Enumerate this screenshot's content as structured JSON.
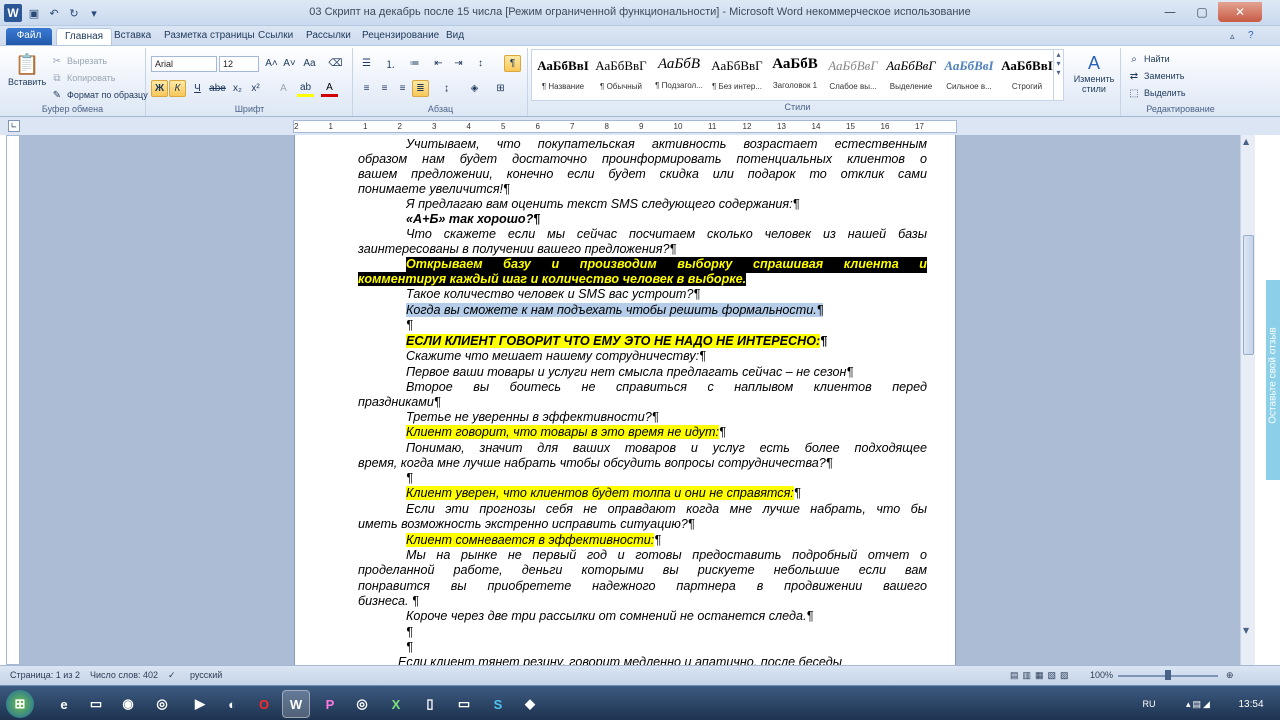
{
  "window": {
    "title": "03 Скрипт на декабрь после 15 числа [Режим ограниченной функциональности]  -  Microsoft Word некоммерческое использование",
    "app_logo": "W"
  },
  "tabs": [
    "Файл",
    "Главная",
    "Вставка",
    "Разметка страницы",
    "Ссылки",
    "Рассылки",
    "Рецензирование",
    "Вид"
  ],
  "ribbon": {
    "clipboard": {
      "paste": "Вставить",
      "cut": "Вырезать",
      "copy": "Копировать",
      "format_painter": "Формат по образцу",
      "label": "Буфер обмена"
    },
    "font": {
      "name": "Arial",
      "size": "12",
      "label": "Шрифт"
    },
    "paragraph_label": "Абзац",
    "styles": {
      "label": "Стили",
      "items": [
        {
          "sample": "АаБбВвI",
          "name": "¶ Название"
        },
        {
          "sample": "АаБбВвГ",
          "name": "¶ Обычный"
        },
        {
          "sample": "АаБбВ",
          "name": "¶ Подзагол..."
        },
        {
          "sample": "АаБбВвГ",
          "name": "¶ Без интер..."
        },
        {
          "sample": "АаБбВ",
          "name": "Заголовок 1"
        },
        {
          "sample": "АаБбВвГ",
          "name": "Слабое вы..."
        },
        {
          "sample": "АаБбВвГ",
          "name": "Выделение"
        },
        {
          "sample": "АаБбВвІ",
          "name": "Сильное в..."
        },
        {
          "sample": "АаБбВвІ",
          "name": "Строгий"
        }
      ],
      "change": "Изменить стили"
    },
    "editing": {
      "find": "Найти",
      "replace": "Заменить",
      "select": "Выделить",
      "label": "Редактирование"
    }
  },
  "ruler_numbers": [
    "2",
    "1",
    "1",
    "2",
    "3",
    "4",
    "5",
    "6",
    "7",
    "8",
    "9",
    "10",
    "11",
    "12",
    "13",
    "14",
    "15",
    "16",
    "17"
  ],
  "document_lines": [
    {
      "t": "Учитываем, что покупательская активность возрастает естественным"
    },
    {
      "t": "образом нам будет достаточно проинформировать потенциальных клиентов о"
    },
    {
      "t": "вашем предложении, конечно если будет скидка или подарок то отклик сами"
    },
    {
      "t": "понимаете увеличится!¶"
    },
    {
      "t": "Я предлагаю вам оценить текст SMS следующего содержания:¶"
    },
    {
      "t": "«А+Б» так хорошо?¶"
    },
    {
      "t": "Что скажете если мы сейчас посчитаем сколько человек из нашей базы"
    },
    {
      "t": "заинтересованы в получении вашего предложения?¶"
    },
    {
      "t": "Открываем базу и производим выборку спрашивая клиента и"
    },
    {
      "t": "комментируя каждый шаг и количество человек в выборке."
    },
    {
      "t": "Такое количество человек и SMS вас устроит?¶"
    },
    {
      "t": "Когда вы сможете к нам подъехать чтобы решить формальности.¶"
    },
    {
      "t": "¶"
    },
    {
      "t": "ЕСЛИ КЛИЕНТ ГОВОРИТ ЧТО ЕМУ ЭТО НЕ НАДО НЕ ИНТЕРЕСНО:"
    },
    {
      "t": "Скажите что мешает нашему сотрудничеству:¶"
    },
    {
      "t": "Первое ваши товары и услуги нет смысла предлагать сейчас – не сезон¶"
    },
    {
      "t": "Второе вы боитесь не справиться с наплывом клиентов перед"
    },
    {
      "t": "праздниками¶"
    },
    {
      "t": "Третье не уверенны в эффективности?¶"
    },
    {
      "t": "Клиент говорит, что товары в это время не идут:"
    },
    {
      "t": "Понимаю, значит для ваших товаров и услуг есть более подходящее"
    },
    {
      "t": "время, когда мне лучше набрать чтобы обсудить вопросы сотрудничества?¶"
    },
    {
      "t": "¶"
    },
    {
      "t": "Клиент уверен, что клиентов будет толпа и они не справятся:"
    },
    {
      "t": "Если эти прогнозы себя не оправдают когда мне лучше набрать, что бы"
    },
    {
      "t": "иметь возможность экстренно исправить ситуацию?¶"
    },
    {
      "t": "Клиент сомневается в эффективности:"
    },
    {
      "t": "Мы на рынке не первый год и готовы предоставить подробный отчет о"
    },
    {
      "t": "проделанной работе, деньги которыми вы рискуете небольшие если вам"
    },
    {
      "t": "понравится вы приобретете надежного партнера в продвижении вашего"
    },
    {
      "t": "бизнеса. ¶"
    },
    {
      "t": "Короче через две три рассылки от сомнений не останется следа.¶"
    },
    {
      "t": "¶"
    },
    {
      "t": "¶"
    },
    {
      "t": "Если клиент тянет резину, говорит медленно и апатично, после беседы"
    }
  ],
  "side_panel": "Оставьте свой отзыв",
  "status": {
    "page": "Страница: 1 из 2",
    "words": "Число слов: 402",
    "lang": "русский",
    "zoom": "100%"
  },
  "taskbar": {
    "lang": "RU",
    "time": "13:54"
  }
}
